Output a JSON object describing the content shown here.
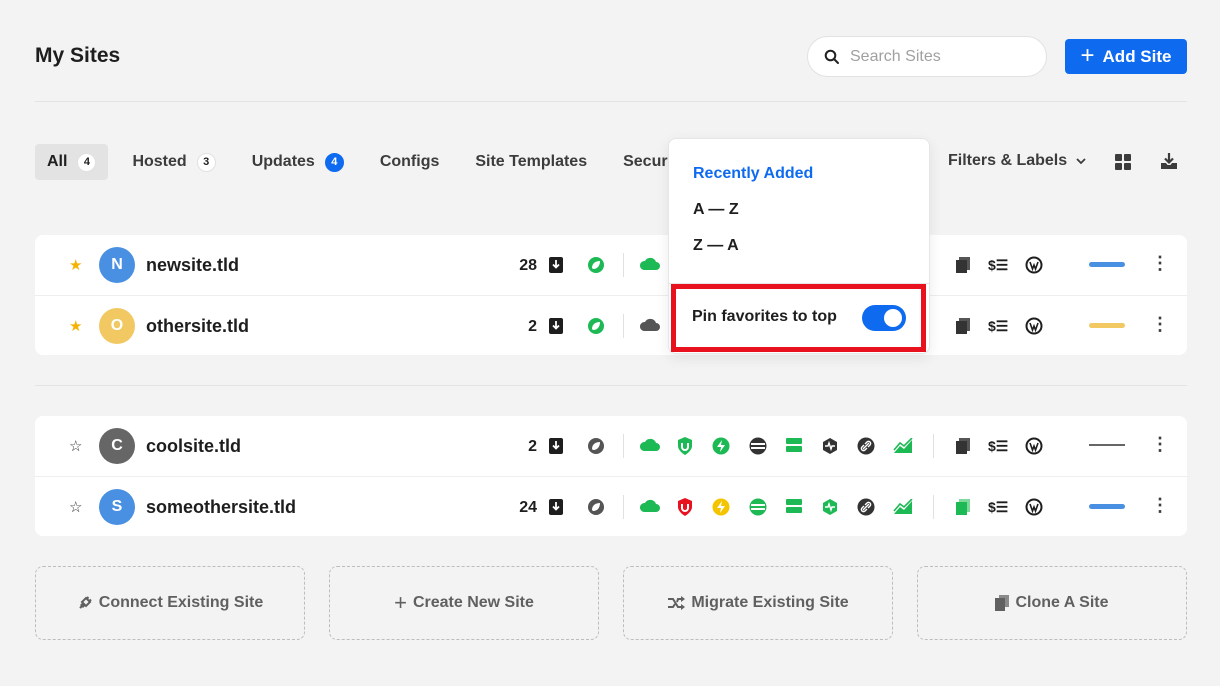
{
  "header": {
    "title": "My Sites",
    "search_placeholder": "Search Sites",
    "add_site_label": "Add Site"
  },
  "tabs": [
    {
      "label": "All",
      "count": "4"
    },
    {
      "label": "Hosted",
      "count": "3"
    },
    {
      "label": "Updates",
      "count": "4"
    },
    {
      "label": "Configs"
    },
    {
      "label": "Site Templates"
    },
    {
      "label": "Secur"
    }
  ],
  "filters_label": "Filters & Labels",
  "sort_menu": {
    "options": [
      "Recently Added",
      "A — Z",
      "Z — A"
    ],
    "selected": "Recently Added",
    "pin_favorites_label": "Pin favorites to top",
    "pin_favorites_on": true
  },
  "favorite_sites": [
    {
      "name": "newsite.tld",
      "initial": "N",
      "avatar_color": "#4a90e2",
      "favorite": true,
      "updates": "28",
      "status_color": "#4a90e2"
    },
    {
      "name": "othersite.tld",
      "initial": "O",
      "avatar_color": "#f2c862",
      "favorite": true,
      "updates": "2",
      "status_color": "#f2c862"
    }
  ],
  "other_sites": [
    {
      "name": "coolsite.tld",
      "initial": "C",
      "avatar_color": "#666666",
      "favorite": false,
      "updates": "2",
      "status": "line"
    },
    {
      "name": "someothersite.tld",
      "initial": "S",
      "avatar_color": "#4a90e2",
      "favorite": false,
      "updates": "24",
      "status_color": "#4a90e2"
    }
  ],
  "actions": [
    {
      "label": "Connect Existing Site",
      "icon": "plug-icon"
    },
    {
      "label": "Create New Site",
      "icon": "plus-icon"
    },
    {
      "label": "Migrate Existing Site",
      "icon": "migrate-icon"
    },
    {
      "label": "Clone A Site",
      "icon": "copy-icon"
    }
  ],
  "colors": {
    "accent": "#0e6bf0",
    "green": "#1db954",
    "red": "#e8121f",
    "yellow": "#f5c400",
    "star": "#f5b300"
  }
}
